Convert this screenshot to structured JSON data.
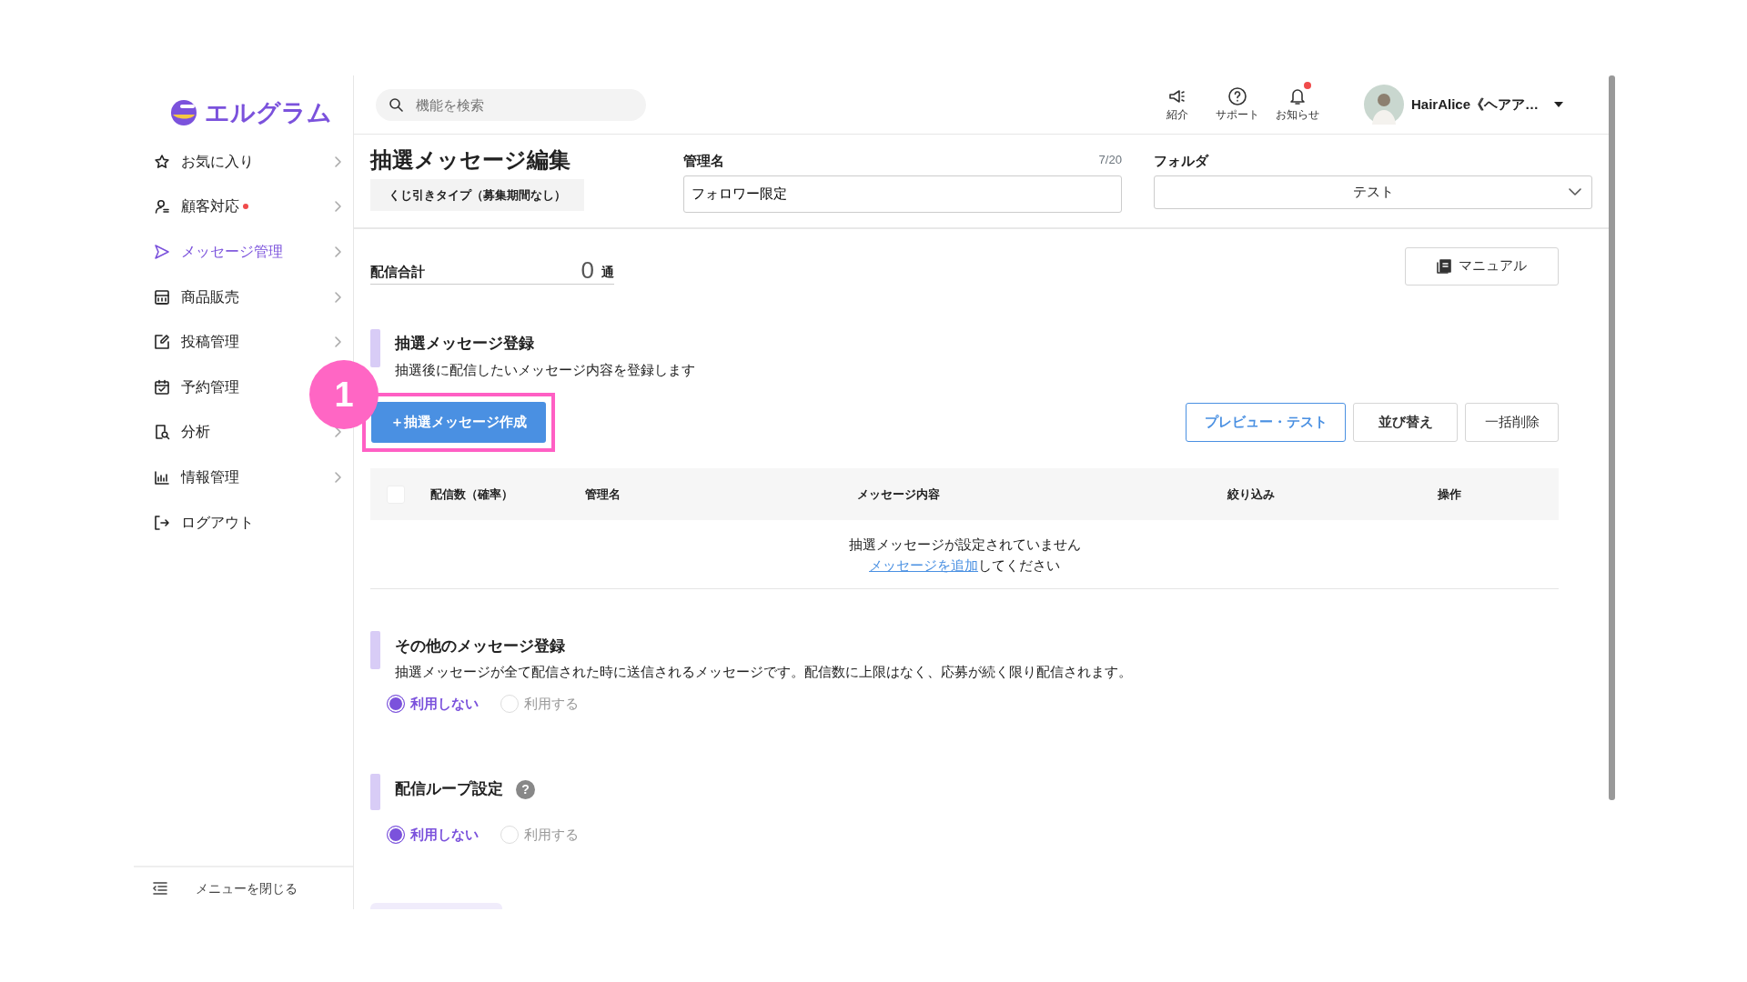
{
  "logo": {
    "text": "エルグラム"
  },
  "sidebar": {
    "items": [
      {
        "kind": "star",
        "label": "お気に入り",
        "selected": false,
        "alert": false,
        "chevron": true
      },
      {
        "kind": "person",
        "label": "顧客対応",
        "selected": false,
        "alert": true,
        "chevron": true
      },
      {
        "kind": "send",
        "label": "メッセージ管理",
        "selected": true,
        "alert": false,
        "chevron": true
      },
      {
        "kind": "shop",
        "label": "商品販売",
        "selected": false,
        "alert": false,
        "chevron": true
      },
      {
        "kind": "edit",
        "label": "投稿管理",
        "selected": false,
        "alert": false,
        "chevron": true
      },
      {
        "kind": "calendar",
        "label": "予約管理",
        "selected": false,
        "alert": false,
        "chevron": false
      },
      {
        "kind": "analysis",
        "label": "分析",
        "selected": false,
        "alert": false,
        "chevron": true
      },
      {
        "kind": "chart",
        "label": "情報管理",
        "selected": false,
        "alert": false,
        "chevron": true
      },
      {
        "kind": "logout",
        "label": "ログアウト",
        "selected": false,
        "alert": false,
        "chevron": false
      }
    ],
    "close_label": "メニューを閉じる"
  },
  "header": {
    "search": {
      "placeholder": "機能を検索"
    },
    "icons": [
      {
        "kind": "megaphone",
        "label": "紹介",
        "dot": false
      },
      {
        "kind": "help",
        "label": "サポート",
        "dot": false
      },
      {
        "kind": "bell",
        "label": "お知らせ",
        "dot": true
      }
    ],
    "user": {
      "name": "HairAlice《ヘアア…"
    }
  },
  "editor": {
    "title": "抽選メッセージ編集",
    "type_badge": "くじ引きタイプ（募集期間なし）",
    "name_field": {
      "label": "管理名",
      "counter": "7/20",
      "value": "フォロワー限定"
    },
    "folder": {
      "label": "フォルダ",
      "value": "テスト"
    }
  },
  "summary": {
    "label": "配信合計",
    "count": "0",
    "unit": "通",
    "manual_button": "マニュアル"
  },
  "lottery_section": {
    "heading": "抽選メッセージ登録",
    "description": "抽選後に配信したいメッセージ内容を登録します",
    "create_button": "＋抽選メッセージ作成",
    "step": "1",
    "actions": [
      {
        "kind": "outline",
        "label": "プレビュー・テスト"
      },
      {
        "kind": "plain",
        "label": "並び替え"
      },
      {
        "kind": "plain",
        "label": "一括削除"
      }
    ],
    "table": {
      "select_all_checked": false,
      "columns": [
        "配信数（確率）",
        "管理名",
        "メッセージ内容",
        "絞り込み",
        "操作"
      ],
      "empty_text": "抽選メッセージが設定されていません",
      "empty_link": "メッセージを追加",
      "empty_suffix": "してください"
    }
  },
  "option_sections": [
    {
      "heading": "その他のメッセージ登録",
      "description": "抽選メッセージが全て配信された時に送信されるメッセージです。配信数に上限はなく、応募が続く限り配信されます。",
      "options": [
        {
          "label": "利用しない",
          "selected": true
        },
        {
          "label": "利用する",
          "selected": false
        }
      ]
    },
    {
      "heading": "配信ループ設定",
      "help_icon": "?",
      "options": [
        {
          "label": "利用しない",
          "selected": true
        },
        {
          "label": "利用する",
          "selected": false
        }
      ]
    }
  ]
}
